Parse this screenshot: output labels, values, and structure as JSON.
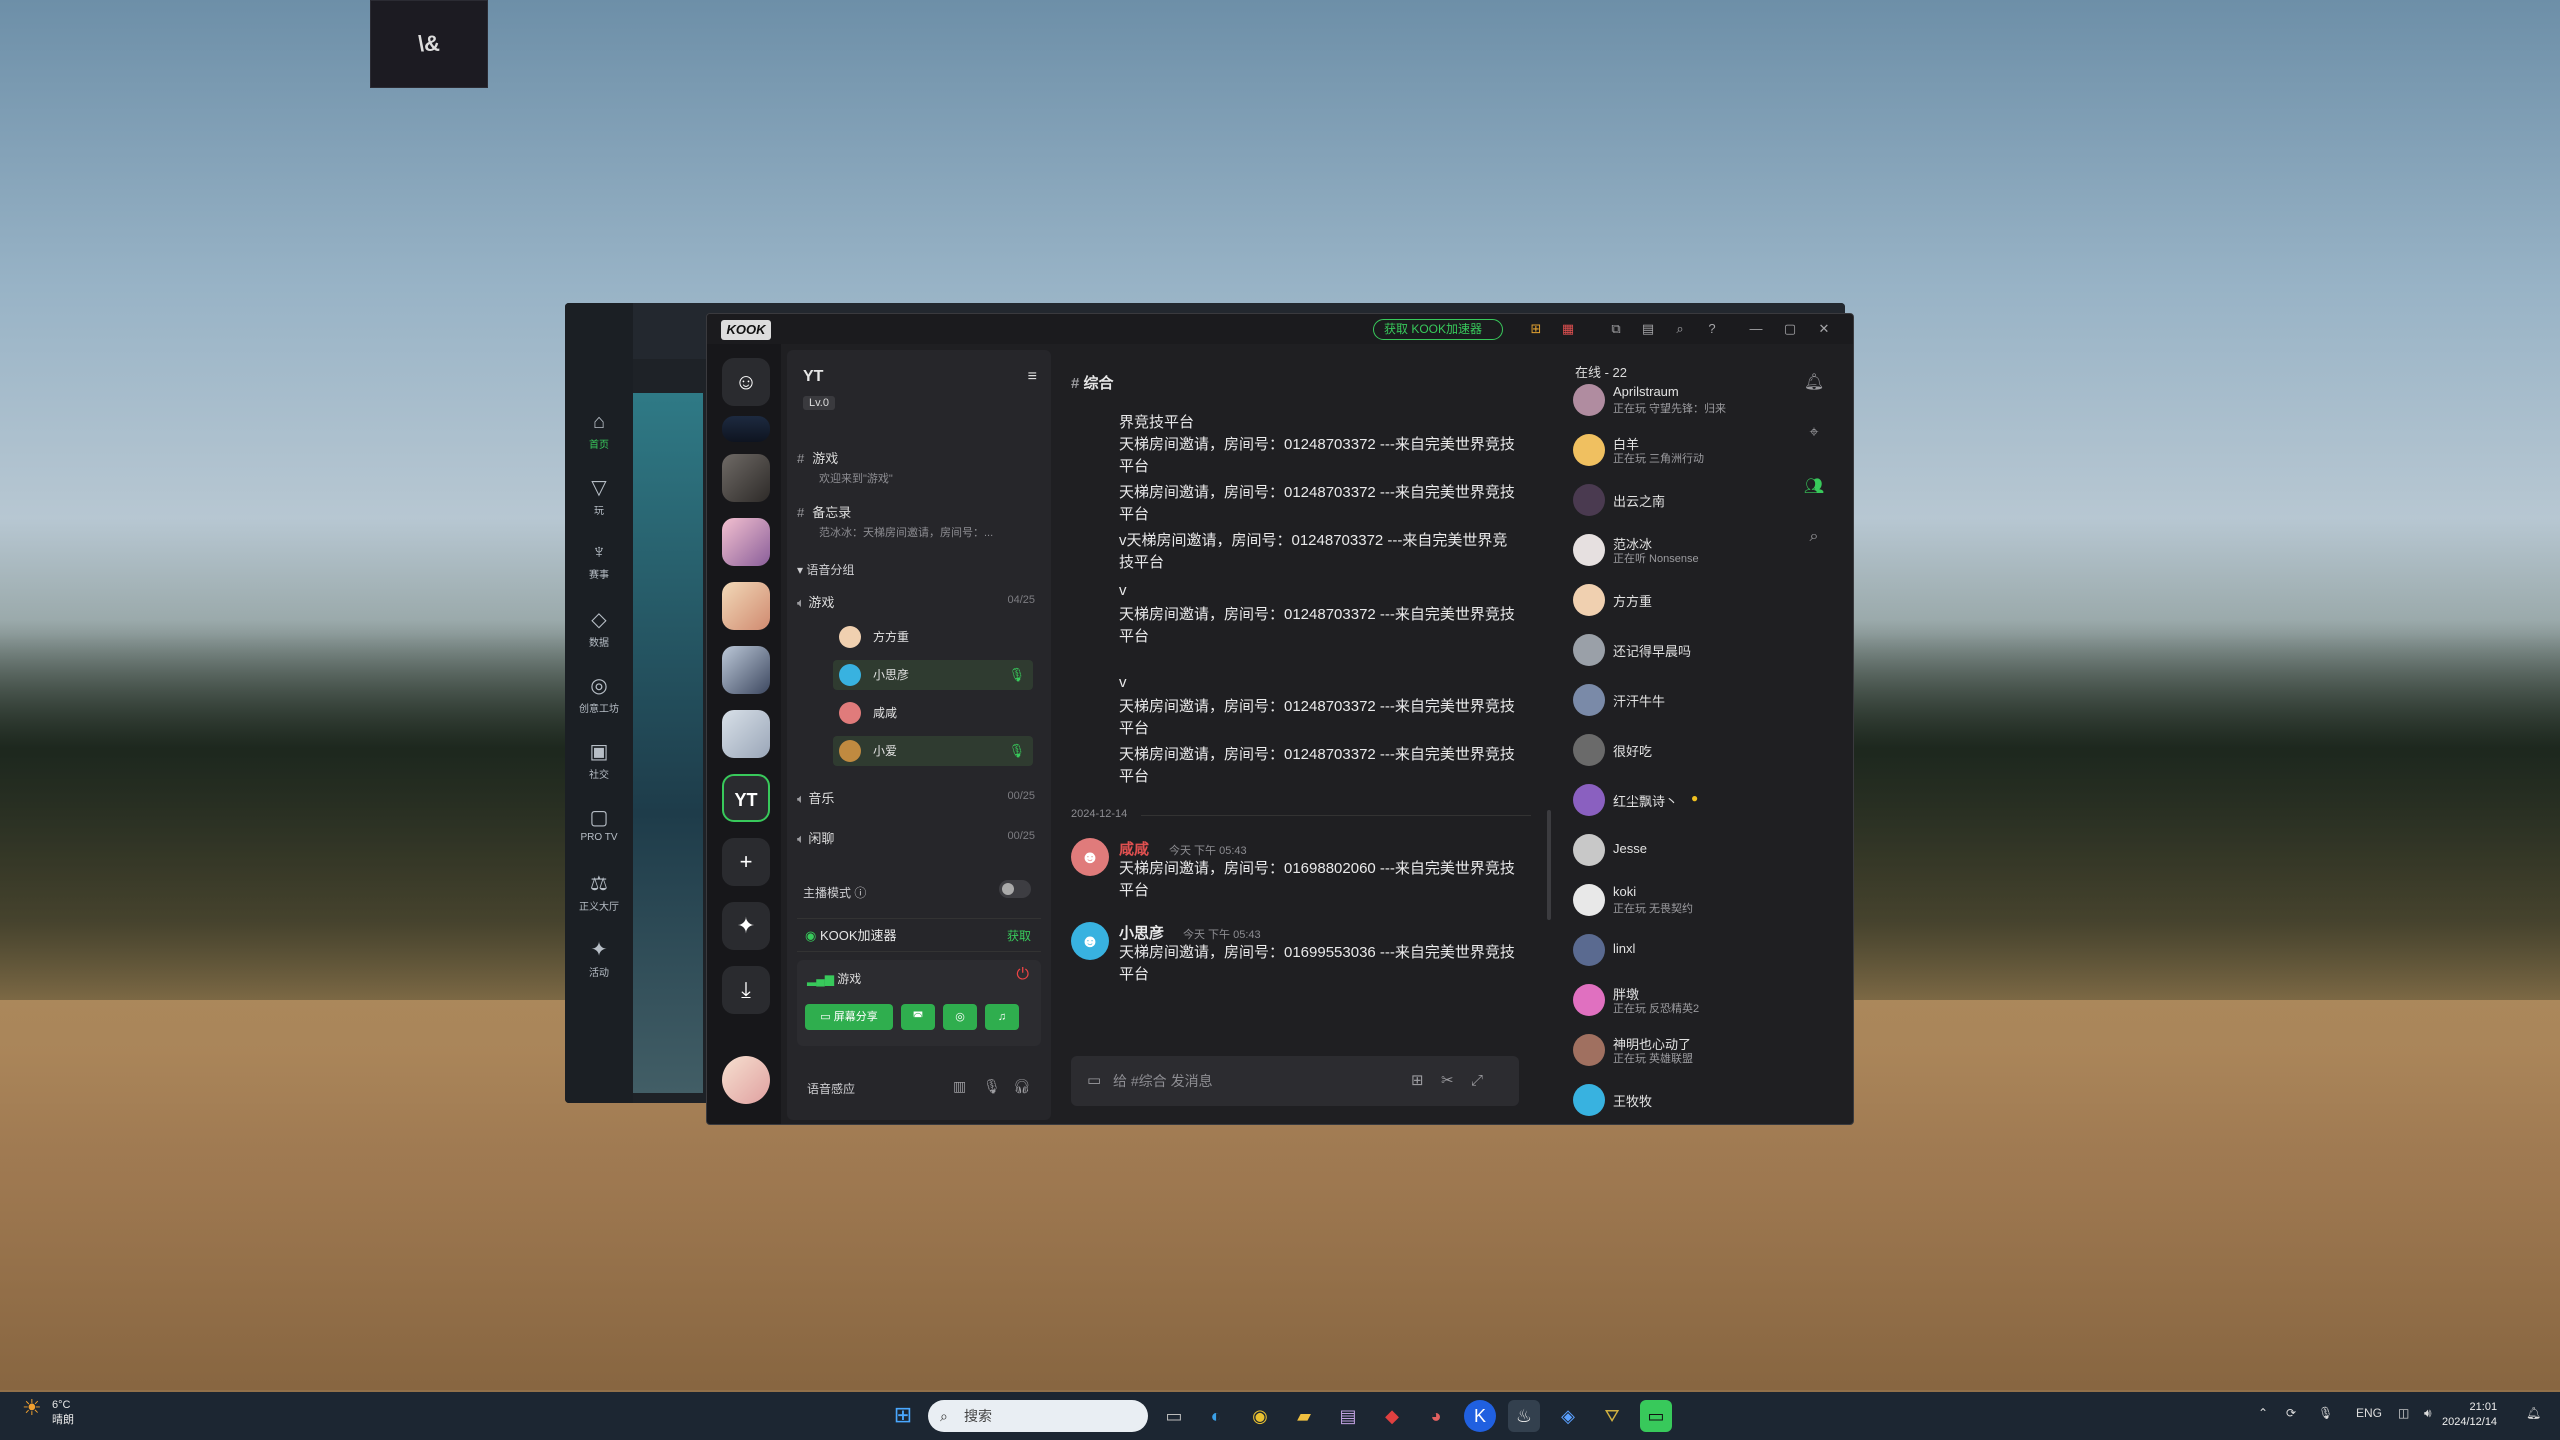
{
  "colors": {
    "accent": "#38c95b",
    "danger": "#e44444",
    "bg": "#1f1f22"
  },
  "desktop": {
    "icon": "game-shortcut-icon",
    "icon_text": "\\&"
  },
  "bg_app": {
    "nav": [
      "首页",
      "玩",
      "赛事",
      "数据",
      "创意工坊",
      "社交",
      "PRO TV",
      "正义大厅",
      "活动"
    ]
  },
  "titlebar": {
    "logo": "KOOK",
    "accel_label": "获取 KOOK加速器"
  },
  "rail": {
    "current_server": "YT"
  },
  "sidebar": {
    "server_name": "YT",
    "level": "Lv.0",
    "channels": [
      {
        "name": "游戏",
        "sub": "欢迎来到\"游戏\""
      },
      {
        "name": "备忘录",
        "sub": "范冰冰：天梯房间邀请，房间号：..."
      }
    ],
    "voice_category": "语音分组",
    "voice_channels": [
      {
        "name": "游戏",
        "count": "04/25"
      },
      {
        "name": "音乐",
        "count": "00/25"
      },
      {
        "name": "闲聊",
        "count": "00/25"
      }
    ],
    "voice_users": [
      "方方重",
      "小思彦",
      "咸咸",
      "小爱"
    ],
    "anchor_mode": "主播模式",
    "accel": {
      "label": "KOOK加速器",
      "action": "获取"
    },
    "voice_panel": {
      "channel": "游戏",
      "share_label": "屏幕分享"
    },
    "voice_sense": "语音感应"
  },
  "chat": {
    "channel": "综合",
    "lines": [
      "界竞技平台",
      "天梯房间邀请，房间号：01248703372 ---来自完美世界竞技平台",
      "天梯房间邀请，房间号：01248703372 ---来自完美世界竞技平台",
      "v天梯房间邀请，房间号：01248703372 ---来自完美世界竞技平台",
      "v",
      "天梯房间邀请，房间号：01248703372 ---来自完美世界竞技平台",
      "v",
      "天梯房间邀请，房间号：01248703372 ---来自完美世界竞技平台",
      "天梯房间邀请，房间号：01248703372 ---来自完美世界竞技平台"
    ],
    "date_divider": "2024-12-14",
    "messages": [
      {
        "author": "咸咸",
        "time": "今天 下午 05:43",
        "text": "天梯房间邀请，房间号：01698802060 ---来自完美世界竞技平台"
      },
      {
        "author": "小思彦",
        "time": "今天 下午 05:43",
        "text": "天梯房间邀请，房间号：01699553036 ---来自完美世界竞技平台"
      }
    ],
    "input_placeholder": "给 #综合 发消息"
  },
  "members": {
    "header": "在线 - 22",
    "list": [
      {
        "name": "Aprilstraum",
        "status": "正在玩 守望先锋：归来"
      },
      {
        "name": "白羊",
        "status": "正在玩 三角洲行动"
      },
      {
        "name": "出云之南",
        "status": ""
      },
      {
        "name": "范冰冰",
        "status": "正在听 Nonsense"
      },
      {
        "name": "方方重",
        "status": ""
      },
      {
        "name": "还记得早晨吗",
        "status": ""
      },
      {
        "name": "汗汗牛牛",
        "status": ""
      },
      {
        "name": "很好吃",
        "status": ""
      },
      {
        "name": "红尘飘诗丶",
        "status": ""
      },
      {
        "name": "Jesse",
        "status": ""
      },
      {
        "name": "koki",
        "status": "正在玩 无畏契约"
      },
      {
        "name": "linxl",
        "status": ""
      },
      {
        "name": "胖墩",
        "status": "正在玩 反恐精英2"
      },
      {
        "name": "神明也心动了",
        "status": "正在玩 英雄联盟"
      },
      {
        "name": "王牧牧",
        "status": ""
      }
    ]
  },
  "taskbar": {
    "temp": "6°C",
    "weather": "晴朗",
    "search_placeholder": "搜索",
    "lang": "ENG",
    "time": "21:01",
    "date": "2024/12/14"
  }
}
